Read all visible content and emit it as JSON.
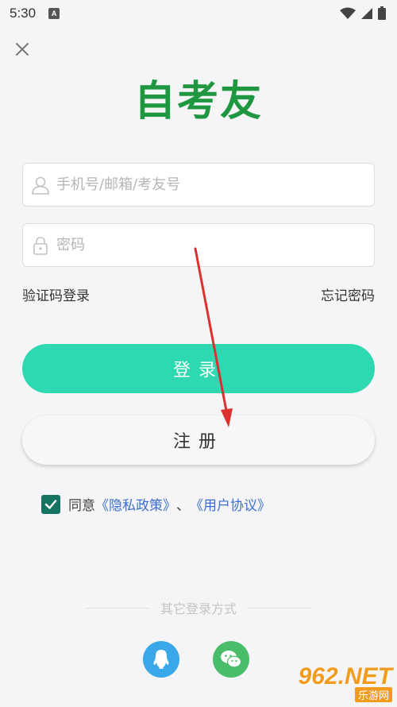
{
  "status_bar": {
    "time": "5:30",
    "app_icon_letter": "A"
  },
  "app": {
    "title": "自考友"
  },
  "form": {
    "account_placeholder": "手机号/邮箱/考友号",
    "password_placeholder": "密码"
  },
  "links": {
    "sms_login": "验证码登录",
    "forgot_password": "忘记密码"
  },
  "buttons": {
    "login": "登录",
    "register": "注册"
  },
  "agreement": {
    "checked": true,
    "prefix": "同意",
    "privacy": "《隐私政策》",
    "separator": "、",
    "terms": "《用户协议》"
  },
  "other_login": {
    "label": "其它登录方式",
    "icons": [
      "qq-icon",
      "wechat-icon"
    ]
  },
  "watermark": {
    "main": "962.NET",
    "sub": "乐游网"
  },
  "colors": {
    "brand_green": "#1f9640",
    "login_button": "#2ed9b2",
    "checkbox": "#127461",
    "link_blue": "#3d6fd0",
    "qq": "#3aa7e8",
    "wechat": "#49bd6a"
  }
}
